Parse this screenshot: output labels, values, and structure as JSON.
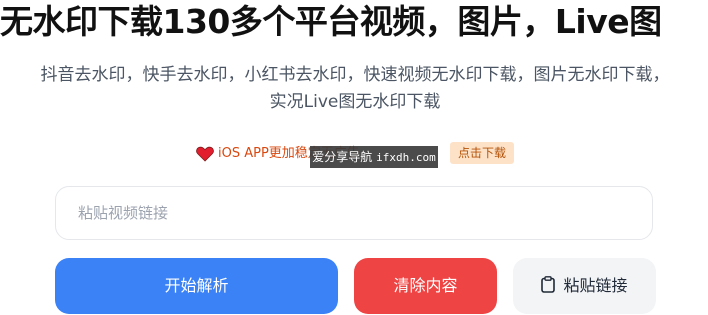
{
  "header": {
    "title": "无水印下载130多个平台视频，图片，Live图",
    "subtitle": "抖音去水印，快手去水印，小红书去水印，快速视频无水印下载，图片无水印下载，实况Live图无水印下载"
  },
  "ios_banner": {
    "text": "iOS APP更加稳定无广告",
    "button": "点击下载"
  },
  "watermark": {
    "cn": "爱分享导航",
    "en": "ifxdh.com"
  },
  "input": {
    "placeholder": "粘贴视频链接",
    "value": ""
  },
  "buttons": {
    "parse": "开始解析",
    "clear": "清除内容",
    "paste": "粘贴链接"
  },
  "colors": {
    "parse": "#3b82f6",
    "clear": "#ef4444",
    "paste": "#f3f4f6",
    "ios_text": "#d9480f",
    "heart": "#e11d2e"
  },
  "icons": {
    "heart": "heart-icon",
    "clipboard": "clipboard-icon"
  }
}
